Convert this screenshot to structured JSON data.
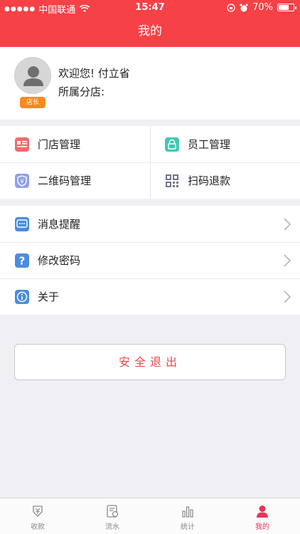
{
  "status_bar": {
    "carrier": "中国联通",
    "time": "15:47",
    "battery": "70%",
    "battery_level": 0.7
  },
  "nav": {
    "title": "我的"
  },
  "profile": {
    "welcome": "欢迎您! 付立省",
    "branch": "所属分店:",
    "role_badge": "店长"
  },
  "grid": {
    "items": [
      {
        "label": "门店管理",
        "icon": "store-card-icon",
        "color": "#ef6b6b"
      },
      {
        "label": "员工管理",
        "icon": "staff-lock-icon",
        "color": "#3fc7b5"
      },
      {
        "label": "二维码管理",
        "icon": "shield-yen-icon",
        "color": "#8f9ff0"
      },
      {
        "label": "扫码退款",
        "icon": "qr-code-icon",
        "color": "#6e7586"
      }
    ]
  },
  "list": {
    "items": [
      {
        "label": "消息提醒",
        "icon": "message-icon",
        "color": "#4a8de0"
      },
      {
        "label": "修改密码",
        "icon": "question-icon",
        "color": "#4a8de0"
      },
      {
        "label": "关于",
        "icon": "info-icon",
        "color": "#4a8de0"
      }
    ]
  },
  "logout": {
    "label": "安全退出"
  },
  "tabs": [
    {
      "label": "收款",
      "icon": "collect-icon",
      "active": false
    },
    {
      "label": "流水",
      "icon": "ledger-icon",
      "active": false
    },
    {
      "label": "统计",
      "icon": "stats-icon",
      "active": false
    },
    {
      "label": "我的",
      "icon": "profile-icon",
      "active": true
    }
  ],
  "colors": {
    "brand": "#f64146",
    "active_tab": "#e8345a",
    "badge": "#f88a1f",
    "logout_text": "#e64a4a"
  }
}
